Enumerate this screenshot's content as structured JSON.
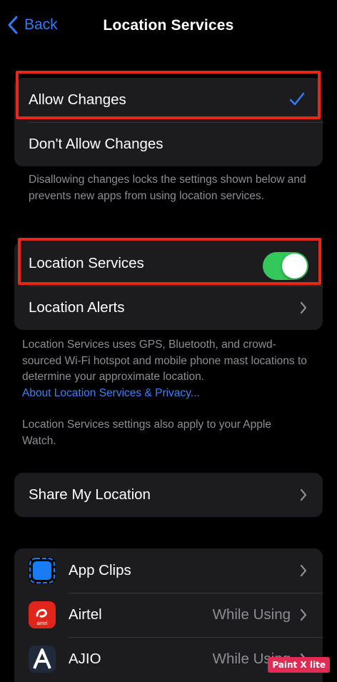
{
  "nav": {
    "back_label": "Back",
    "title": "Location Services"
  },
  "changes_group": {
    "allow_label": "Allow Changes",
    "dont_allow_label": "Don't Allow Changes",
    "footer": "Disallowing changes locks the settings shown below and prevents new apps from using location services."
  },
  "location_group": {
    "location_services_label": "Location Services",
    "location_services_enabled": true,
    "location_alerts_label": "Location Alerts",
    "footer": "Location Services uses GPS, Bluetooth, and crowd-sourced Wi-Fi hotspot and mobile phone mast locations to determine your approximate location.",
    "footer_link": "About Location Services & Privacy...",
    "footer2": "Location Services settings also apply to your Apple Watch."
  },
  "share_group": {
    "share_label": "Share My Location"
  },
  "apps": [
    {
      "name": "App Clips",
      "value": "",
      "icon": "app-clips-icon"
    },
    {
      "name": "Airtel",
      "value": "While Using",
      "icon": "airtel-icon"
    },
    {
      "name": "AJIO",
      "value": "While Using",
      "icon": "ajio-icon"
    }
  ],
  "airtel_icon_text": "airtel",
  "watermark": "Paint X lite",
  "colors": {
    "accent": "#2f7cf6",
    "toggle_on": "#34c759",
    "highlight": "#e8271a",
    "cell_bg": "#1c1c1e"
  }
}
